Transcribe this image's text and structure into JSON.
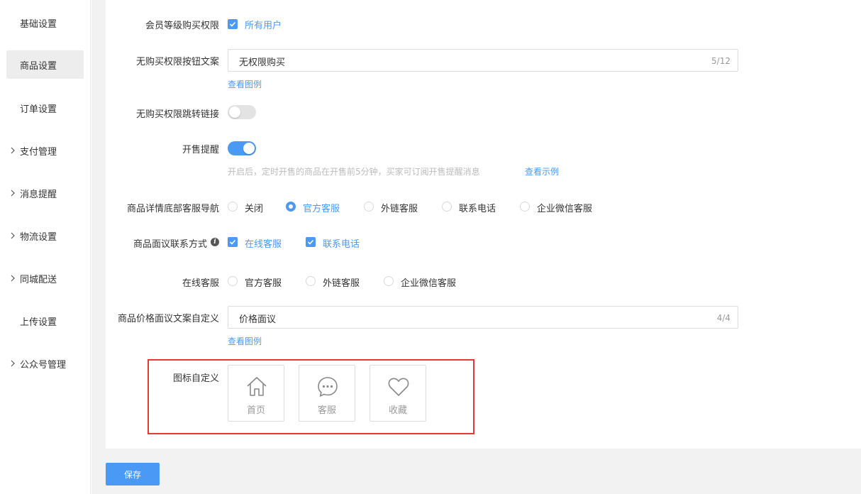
{
  "sidebar": {
    "items": [
      {
        "label": "基础设置",
        "expandable": false,
        "active": false
      },
      {
        "label": "商品设置",
        "expandable": false,
        "active": true
      },
      {
        "label": "订单设置",
        "expandable": false,
        "active": false
      },
      {
        "label": "支付管理",
        "expandable": true,
        "active": false
      },
      {
        "label": "消息提醒",
        "expandable": true,
        "active": false
      },
      {
        "label": "物流设置",
        "expandable": true,
        "active": false
      },
      {
        "label": "同城配送",
        "expandable": true,
        "active": false
      },
      {
        "label": "上传设置",
        "expandable": false,
        "active": false
      },
      {
        "label": "公众号管理",
        "expandable": true,
        "active": false
      }
    ]
  },
  "form": {
    "member_level": {
      "label": "会员等级购买权限",
      "option": "所有用户",
      "checked": true
    },
    "no_permission_button": {
      "label": "无购买权限按钮文案",
      "value": "无权限购买",
      "counter": "5/12",
      "link": "查看图例"
    },
    "no_permission_jump": {
      "label": "无购买权限跳转链接",
      "enabled": false
    },
    "sale_reminder": {
      "label": "开售提醒",
      "enabled": true,
      "hint": "开启后，定时开售的商品在开售前5分钟，买家可订阅开售提醒消息",
      "link": "查看示例"
    },
    "service_nav": {
      "label": "商品详情底部客服导航",
      "options": [
        "关闭",
        "官方客服",
        "外链客服",
        "联系电话",
        "企业微信客服"
      ],
      "selected": "官方客服"
    },
    "negotiation_contact": {
      "label": "商品面议联系方式",
      "info_icon": "info-icon",
      "options": [
        {
          "label": "在线客服",
          "checked": true
        },
        {
          "label": "联系电话",
          "checked": true
        }
      ]
    },
    "online_service": {
      "label": "在线客服",
      "options": [
        "官方客服",
        "外链客服",
        "企业微信客服"
      ],
      "selected": null
    },
    "price_text": {
      "label": "商品价格面议文案自定义",
      "value": "价格面议",
      "counter": "4/4",
      "link": "查看图例"
    },
    "icon_custom": {
      "label": "图标自定义",
      "icons": [
        {
          "label": "首页",
          "icon": "home-icon"
        },
        {
          "label": "客服",
          "icon": "chat-icon"
        },
        {
          "label": "收藏",
          "icon": "heart-icon"
        }
      ]
    }
  },
  "footer": {
    "save_label": "保存"
  },
  "colors": {
    "accent": "#4a9af5",
    "highlight": "#e53935",
    "page_bg": "#f2f2f2"
  }
}
